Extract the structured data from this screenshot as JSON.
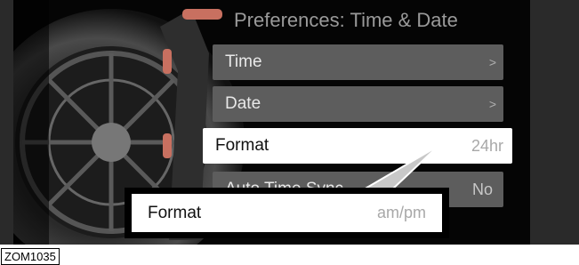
{
  "screen": {
    "title": "Preferences: Time & Date",
    "items": [
      {
        "label": "Time",
        "value": "",
        "chevron": ">"
      },
      {
        "label": "Date",
        "value": "",
        "chevron": ">"
      },
      {
        "label": "Format",
        "value": "24hr",
        "chevron": ""
      },
      {
        "label": "Auto Time Sync",
        "value": "No",
        "chevron": ""
      }
    ]
  },
  "popup": {
    "label": "Format",
    "value": "am/pm"
  },
  "caption": "ZOM1035",
  "colors": {
    "row_bg": "#5d5d5d",
    "selected_bg": "#ffffff",
    "screen_bg": "#000000"
  },
  "icons": {
    "chevron": "chevron-right-icon"
  }
}
